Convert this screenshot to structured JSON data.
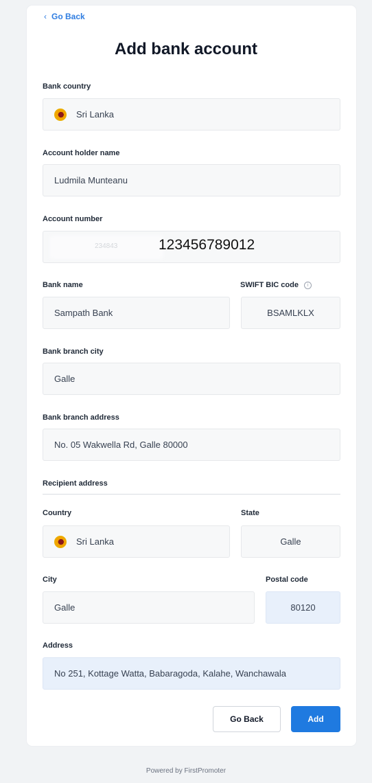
{
  "header": {
    "go_back_link": "Go Back",
    "title": "Add bank account"
  },
  "form": {
    "bank_country": {
      "label": "Bank country",
      "value": "Sri Lanka"
    },
    "account_holder_name": {
      "label": "Account holder name",
      "value": "Ludmila Munteanu"
    },
    "account_number": {
      "label": "Account number",
      "value": "123456789012",
      "masked_hint": "234843"
    },
    "bank_name": {
      "label": "Bank name",
      "value": "Sampath Bank"
    },
    "swift_bic": {
      "label": "SWIFT BIC code",
      "value": "BSAMLKLX"
    },
    "bank_branch_city": {
      "label": "Bank branch city",
      "value": "Galle"
    },
    "bank_branch_address": {
      "label": "Bank branch address",
      "value": "No. 05 Wakwella Rd, Galle 80000"
    },
    "recipient_section": "Recipient address",
    "country": {
      "label": "Country",
      "value": "Sri Lanka"
    },
    "state": {
      "label": "State",
      "value": "Galle"
    },
    "city": {
      "label": "City",
      "value": "Galle"
    },
    "postal_code": {
      "label": "Postal code",
      "value": "80120"
    },
    "address": {
      "label": "Address",
      "value": "No 251, Kottage Watta, Babaragoda, Kalahe, Wanchawala"
    }
  },
  "actions": {
    "go_back": "Go Back",
    "add": "Add"
  },
  "footer": "Powered by FirstPromoter",
  "icons": {
    "flag": "sri-lanka-flag-icon",
    "info": "info-icon",
    "chevron": "chevron-left-icon"
  },
  "colors": {
    "accent": "#1f7ae0",
    "link": "#2f7de1",
    "field_bg": "#f7f8f9",
    "field_autofill_bg": "#e8f0fb"
  }
}
